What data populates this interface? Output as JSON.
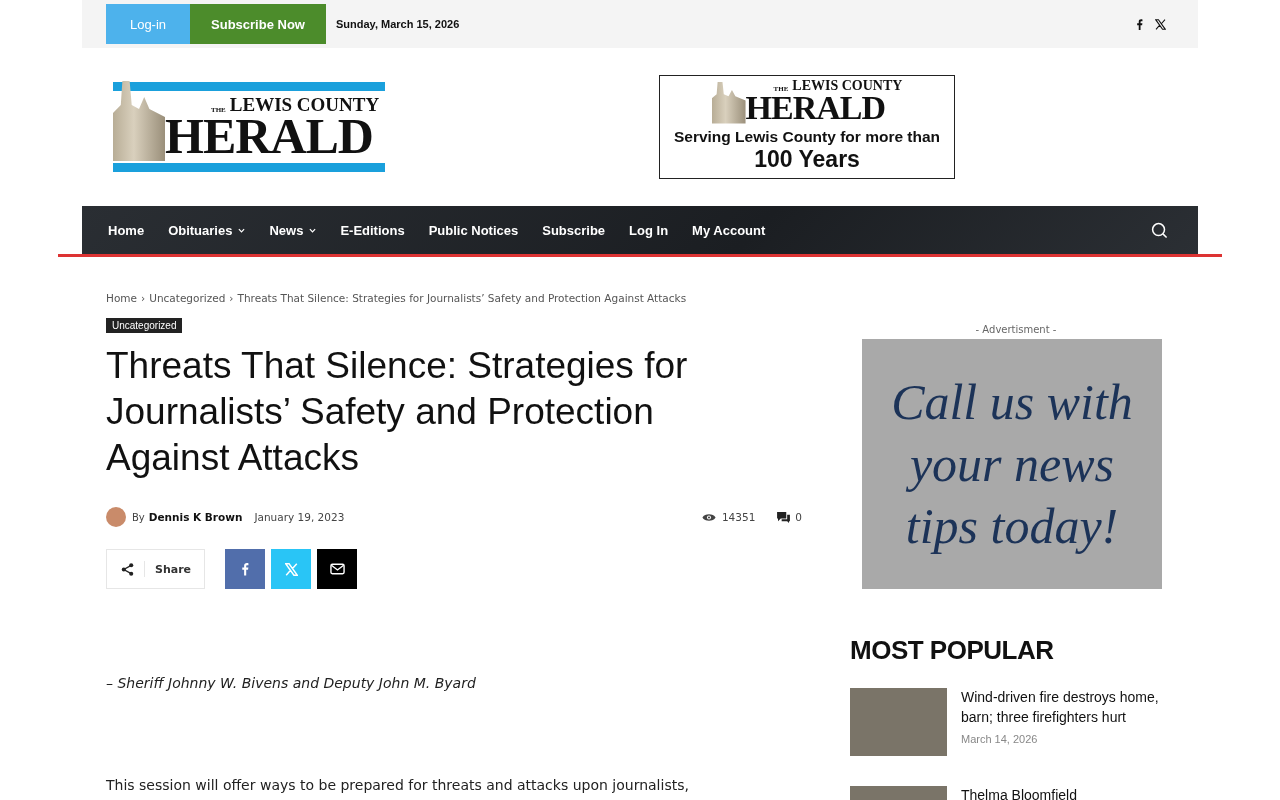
{
  "top_bar": {
    "login": "Log-in",
    "subscribe": "Subscribe Now",
    "date": "Sunday, March 15, 2026",
    "social": [
      {
        "kind": "facebook"
      },
      {
        "kind": "x"
      }
    ]
  },
  "logo": {
    "small": "THE",
    "name": "LEWIS COUNTY",
    "big": "HERALD"
  },
  "header_ad": {
    "small": "THE",
    "name": "LEWIS COUNTY",
    "big": "HERALD",
    "line": "Serving Lewis County for more than",
    "years": "100 Years"
  },
  "nav": [
    {
      "label": "Home",
      "dropdown": false
    },
    {
      "label": "Obituaries",
      "dropdown": true
    },
    {
      "label": "News",
      "dropdown": true
    },
    {
      "label": "E-Editions",
      "dropdown": false
    },
    {
      "label": "Public Notices",
      "dropdown": false
    },
    {
      "label": "Subscribe",
      "dropdown": false
    },
    {
      "label": "Log In",
      "dropdown": false
    },
    {
      "label": "My Account",
      "dropdown": false
    }
  ],
  "breadcrumb_separator": "›",
  "breadcrumb": [
    "Home",
    "Uncategorized",
    "Threats That Silence: Strategies for Journalists’ Safety and Protection Against Attacks"
  ],
  "article": {
    "category": "Uncategorized",
    "title": "Threats That Silence: Strategies for Journalists’ Safety and Protection Against Attacks",
    "by": "By",
    "author": "Dennis K Brown",
    "date": "January 19, 2023",
    "views": "14351",
    "comments": "0",
    "share_label": "Share",
    "share_buttons": [
      {
        "kind": "facebook"
      },
      {
        "kind": "x"
      },
      {
        "kind": "email"
      }
    ],
    "quote": "– Sheriff Johnny W. Bivens and Deputy John M. Byard",
    "body": "This session will offer ways to be prepared for threats and attacks upon journalists,"
  },
  "sidebar": {
    "ad_label": "- Advertisment -",
    "ad_text": "Call us with your news tips today!",
    "popular_title": "MOST POPULAR",
    "popular": [
      {
        "title": "Wind-driven fire destroys home, barn; three firefighters hurt",
        "date": "March 14, 2026"
      },
      {
        "title": "Thelma Bloomfield"
      }
    ]
  }
}
